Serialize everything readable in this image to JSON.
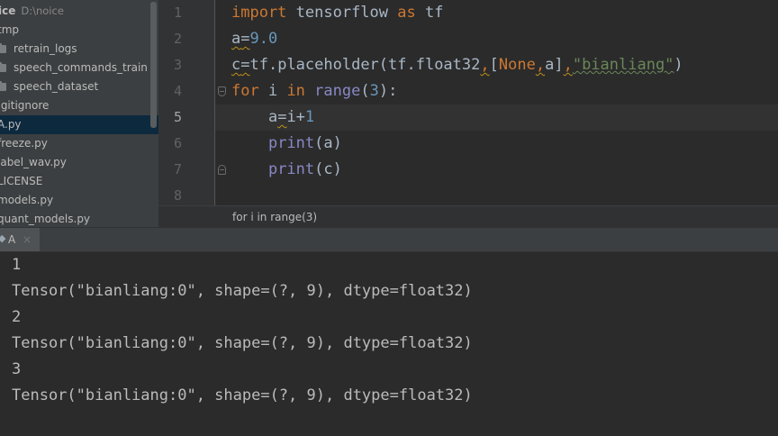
{
  "project_tree": {
    "root": {
      "label": "ice",
      "path": "D:\\noice"
    },
    "items": [
      {
        "label": "tmp",
        "kind": "folder"
      },
      {
        "label": "retrain_logs",
        "kind": "folder"
      },
      {
        "label": "speech_commands_train",
        "kind": "folder"
      },
      {
        "label": "speech_dataset",
        "kind": "folder"
      },
      {
        "label": ".gitignore",
        "kind": "file"
      },
      {
        "label": "A.py",
        "kind": "file",
        "selected": true
      },
      {
        "label": "freeze.py",
        "kind": "file"
      },
      {
        "label": "label_wav.py",
        "kind": "file"
      },
      {
        "label": "LICENSE",
        "kind": "file"
      },
      {
        "label": "models.py",
        "kind": "file"
      },
      {
        "label": "quant_models.py",
        "kind": "file"
      }
    ]
  },
  "editor": {
    "line_numbers": [
      "1",
      "2",
      "3",
      "4",
      "5",
      "6",
      "7",
      "8"
    ],
    "current_line": "5",
    "lines": [
      [
        {
          "t": "import",
          "c": "kw"
        },
        {
          "t": " tensorflow "
        },
        {
          "t": "as",
          "c": "kw"
        },
        {
          "t": " tf"
        }
      ],
      [
        {
          "t": "a",
          "c": "warn"
        },
        {
          "t": "=",
          "c": "warn"
        },
        {
          "t": "9.0",
          "c": "num"
        }
      ],
      [
        {
          "t": "c",
          "c": "warn"
        },
        {
          "t": "=",
          "c": "warn"
        },
        {
          "t": "tf.placeholder(tf.float32"
        },
        {
          "t": ",",
          "c": "kw warn"
        },
        {
          "t": "["
        },
        {
          "t": "None",
          "c": "kw"
        },
        {
          "t": ",",
          "c": "kw warn"
        },
        {
          "t": "a"
        },
        {
          "t": "]"
        },
        {
          "t": ",",
          "c": "kw warn"
        },
        {
          "t": "\"bianliang\"",
          "c": "str"
        },
        {
          "t": ")"
        }
      ],
      [
        {
          "t": "for",
          "c": "kw"
        },
        {
          "t": " i "
        },
        {
          "t": "in",
          "c": "kw"
        },
        {
          "t": " "
        },
        {
          "t": "range",
          "c": "builtin"
        },
        {
          "t": "("
        },
        {
          "t": "3",
          "c": "num"
        },
        {
          "t": "):"
        }
      ],
      [
        {
          "t": "    a"
        },
        {
          "t": "=",
          "c": "warn"
        },
        {
          "t": "i+"
        },
        {
          "t": "1",
          "c": "num"
        }
      ],
      [
        {
          "t": "    "
        },
        {
          "t": "print",
          "c": "builtin"
        },
        {
          "t": "(a)"
        }
      ],
      [
        {
          "t": "    "
        },
        {
          "t": "print",
          "c": "builtin"
        },
        {
          "t": "(c)"
        }
      ],
      []
    ]
  },
  "breadcrumb": {
    "label": "for i in range(3)"
  },
  "run_panel": {
    "tab": {
      "icon": "python-run-icon",
      "label": "A",
      "close": "×"
    },
    "output": [
      "1",
      "Tensor(\"bianliang:0\", shape=(?, 9), dtype=float32)",
      "2",
      "Tensor(\"bianliang:0\", shape=(?, 9), dtype=float32)",
      "3",
      "Tensor(\"bianliang:0\", shape=(?, 9), dtype=float32)"
    ]
  },
  "colors": {
    "keyword": "#cc7832",
    "number": "#6897bb",
    "string": "#6a8759",
    "builtin": "#8888c6",
    "selection": "#0d293e"
  }
}
